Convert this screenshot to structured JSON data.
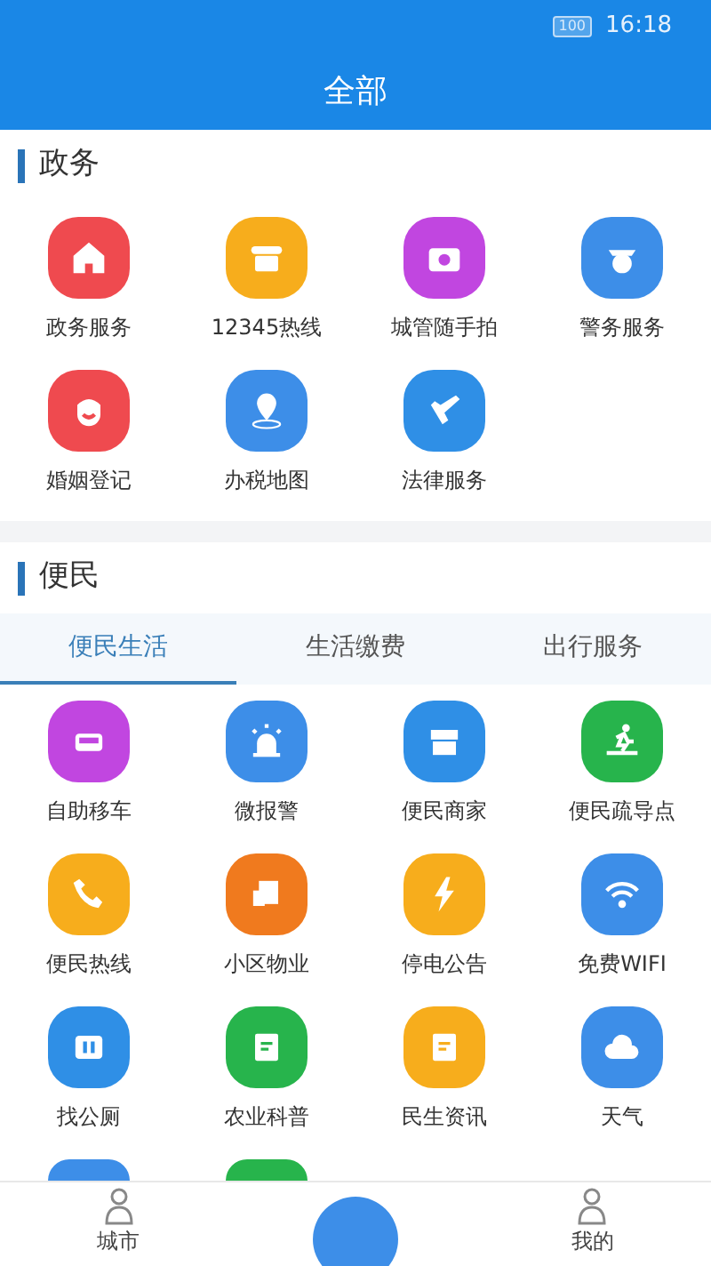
{
  "status_bar": {
    "battery": "100",
    "time": "16:18"
  },
  "header": {
    "title": "全部"
  },
  "sections": [
    {
      "title": "政务",
      "items": [
        {
          "label": "政务服务",
          "color": "#ef4a4f"
        },
        {
          "label": "12345热线",
          "color": "#f7ad1c"
        },
        {
          "label": "城管随手拍",
          "color": "#c146e0"
        },
        {
          "label": "警务服务",
          "color": "#3d8ee8"
        },
        {
          "label": "婚姻登记",
          "color": "#ef4a4f"
        },
        {
          "label": "办税地图",
          "color": "#3d8ee8"
        },
        {
          "label": "法律服务",
          "color": "#2f8fe6"
        }
      ]
    },
    {
      "title": "便民",
      "tabs": [
        {
          "label": "便民生活",
          "selected": true
        },
        {
          "label": "生活缴费",
          "selected": false
        },
        {
          "label": "出行服务",
          "selected": false
        }
      ],
      "items": [
        {
          "label": "自助移车",
          "color": "#c146e0"
        },
        {
          "label": "微报警",
          "color": "#3d8ee8"
        },
        {
          "label": "便民商家",
          "color": "#2f8fe6"
        },
        {
          "label": "便民疏导点",
          "color": "#27b44c"
        },
        {
          "label": "便民热线",
          "color": "#f7ad1c"
        },
        {
          "label": "小区物业",
          "color": "#f07a1e"
        },
        {
          "label": "停电公告",
          "color": "#f7ad1c"
        },
        {
          "label": "免费WIFI",
          "color": "#3d8ee8"
        },
        {
          "label": "找公厕",
          "color": "#2f8fe6"
        },
        {
          "label": "农业科普",
          "color": "#27b44c"
        },
        {
          "label": "民生资讯",
          "color": "#f7ad1c"
        },
        {
          "label": "天气",
          "color": "#3d8ee8"
        },
        {
          "kind": "partial",
          "color": "#3d8ee8"
        },
        {
          "kind": "partial",
          "color": "#27b44c"
        }
      ]
    }
  ],
  "bottom_nav": [
    {
      "label": "城市",
      "kind": "tab"
    },
    {
      "kind": "center"
    },
    {
      "label": "我的",
      "kind": "tab"
    }
  ]
}
